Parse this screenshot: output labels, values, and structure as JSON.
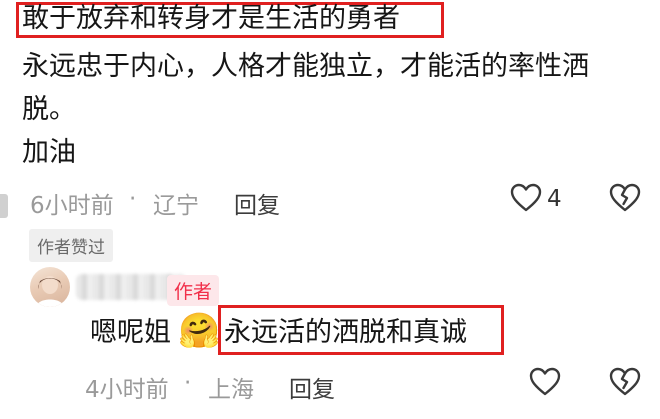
{
  "comment": {
    "highlight_text": "敢于放弃和转身才是生活的勇者",
    "body_line1": "永远忠于内心，人格才能独立，才能活的率性洒",
    "body_line2": "脱。",
    "body_line3": "加油",
    "time": "6小时前",
    "sep": "·",
    "location": "辽宁",
    "reply_label": "回复",
    "like_count": "4",
    "author_liked_badge": "作者赞过"
  },
  "reply": {
    "author_badge": "作者",
    "text_prefix": "嗯呢姐",
    "emoji": "🤗",
    "highlight_text": "永远活的洒脱和真诚",
    "time": "4小时前",
    "sep": "·",
    "location": "上海",
    "reply_label": "回复"
  },
  "colors": {
    "highlight_border": "#e02020",
    "author_badge_text": "#f12f4a",
    "meta_text": "#9a9a9a"
  },
  "icons": {
    "like": "heart-outline-icon",
    "dislike": "broken-heart-icon"
  }
}
